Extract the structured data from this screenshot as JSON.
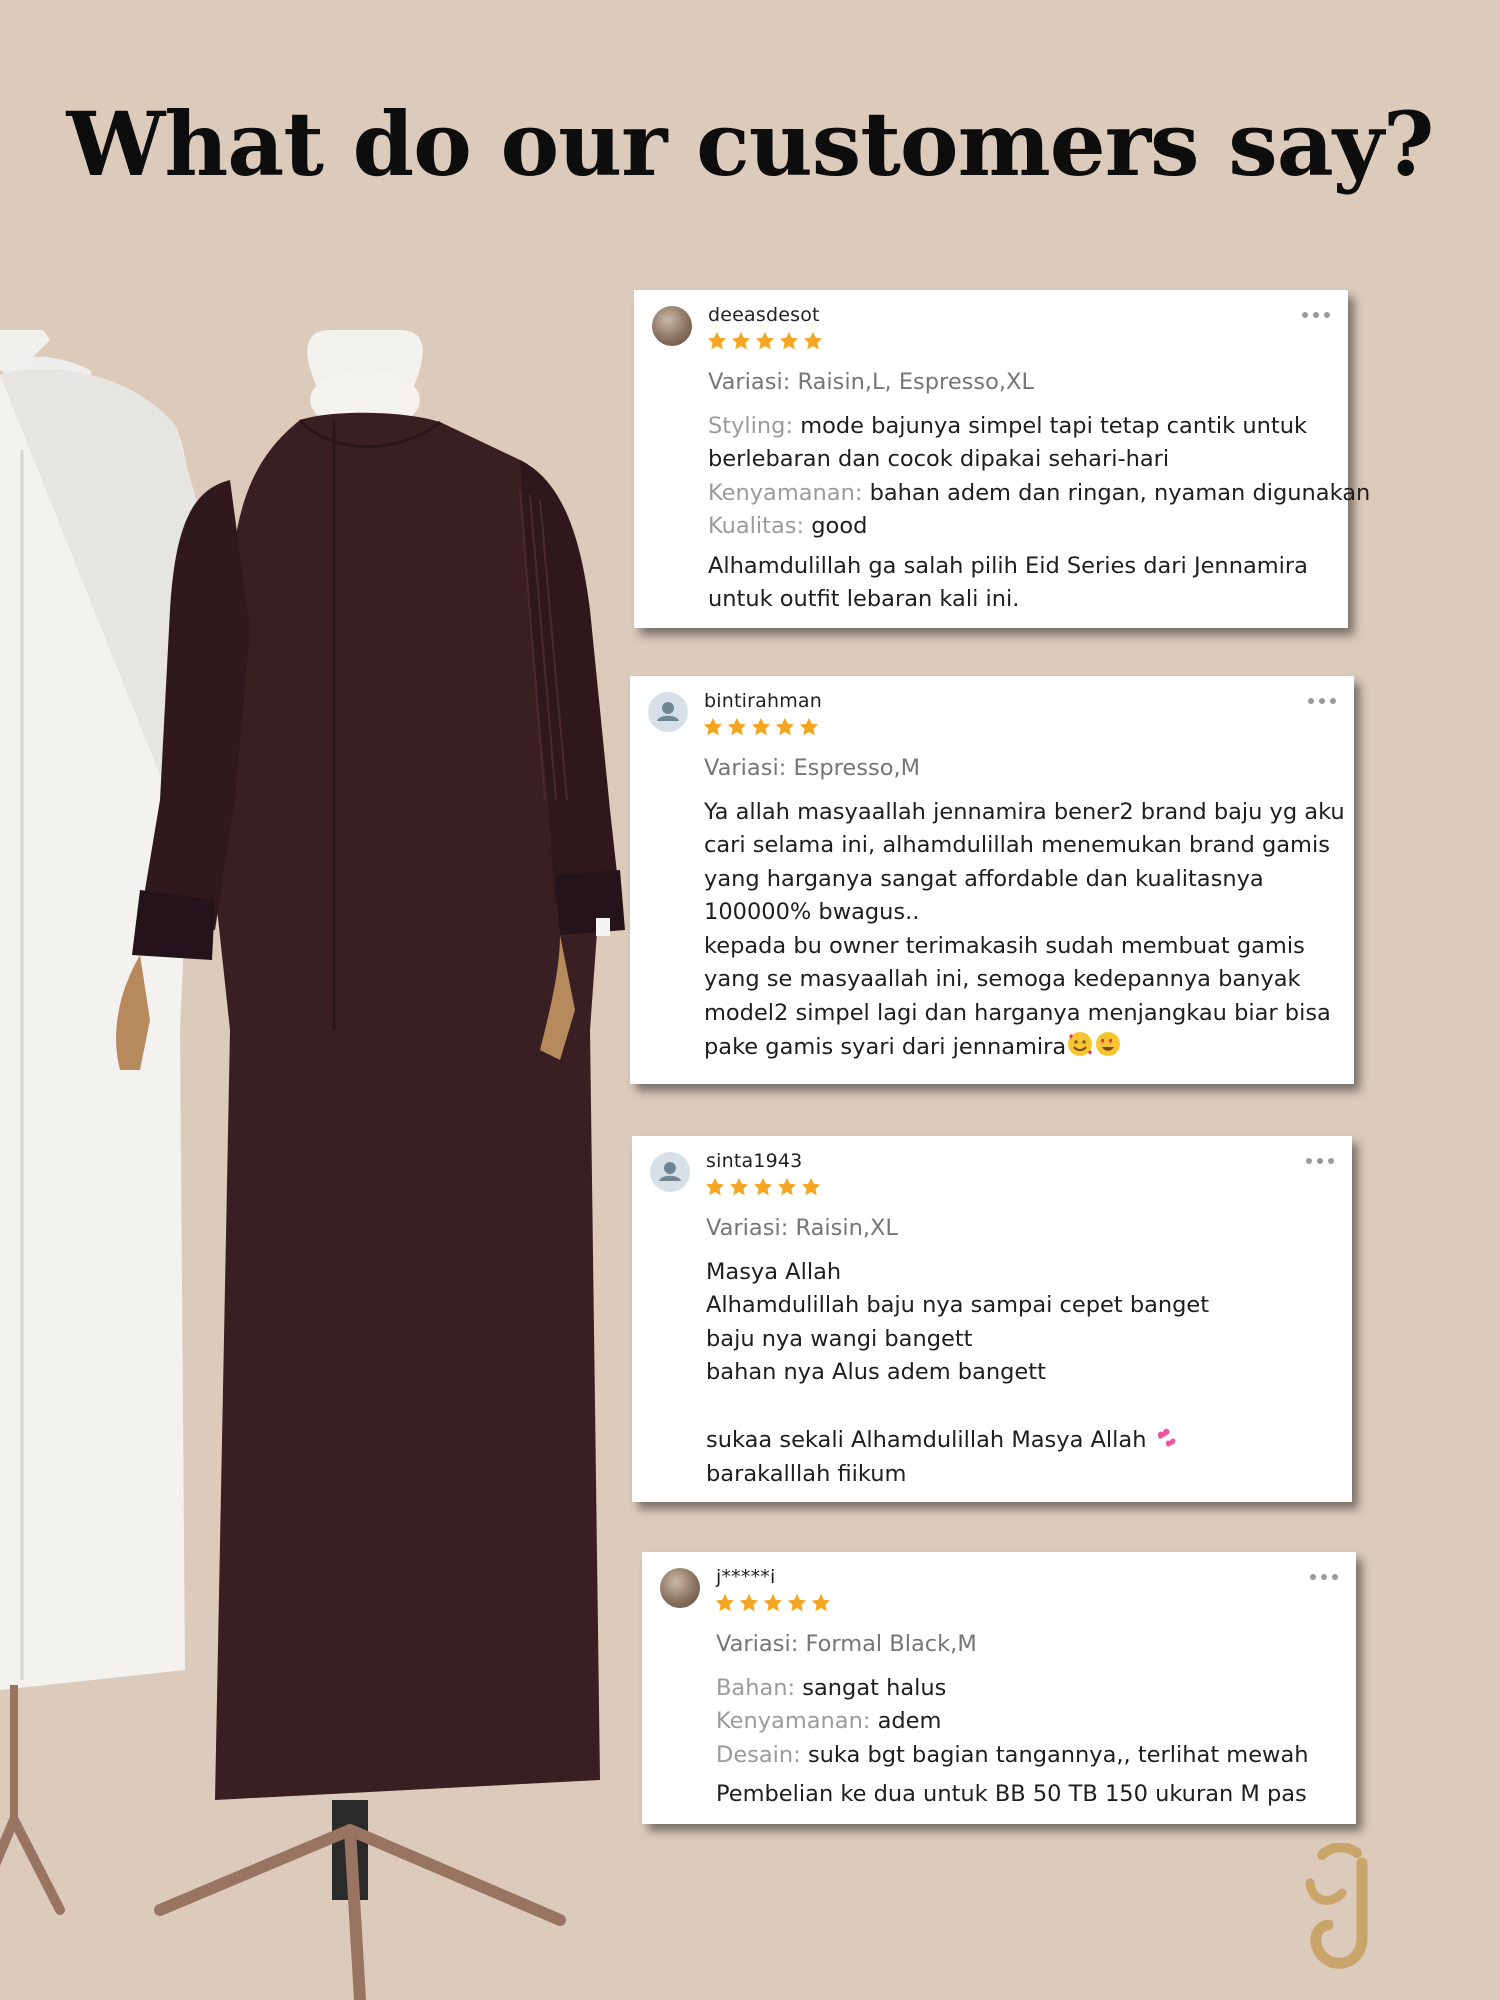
{
  "headline": "What do our customers say?",
  "reviews": [
    {
      "username": "deeasdesot",
      "stars": 5,
      "variasi_label": "Variasi:",
      "variasi_value": "Raisin,L, Espresso,XL",
      "fields": [
        {
          "label": "Styling:",
          "lines": [
            "mode bajunya simpel tapi tetap cantik untuk",
            "berlebaran dan cocok dipakai sehari-hari"
          ]
        },
        {
          "label": "Kenyamanan:",
          "lines": [
            "bahan adem dan ringan, nyaman digunakan"
          ]
        },
        {
          "label": "Kualitas:",
          "lines": [
            "good"
          ]
        }
      ],
      "text_lines": [
        "Alhamdulillah ga salah pilih Eid Series dari Jennamira",
        "untuk outfit lebaran kali ini."
      ]
    },
    {
      "username": "bintirahman",
      "stars": 5,
      "variasi_label": "Variasi:",
      "variasi_value": "Espresso,M",
      "text_lines": [
        "Ya allah masyaallah jennamira bener2 brand baju yg aku",
        "cari selama ini, alhamdulillah menemukan brand gamis",
        "yang harganya sangat affordable dan kualitasnya",
        "100000% bwagus..",
        "kepada bu owner terimakasih sudah membuat gamis",
        "yang se masyaallah ini, semoga kedepannya banyak",
        "model2 simpel lagi dan harganya menjangkau biar bisa",
        "pake gamis syari dari jennamira"
      ]
    },
    {
      "username": "sinta1943",
      "stars": 5,
      "variasi_label": "Variasi:",
      "variasi_value": "Raisin,XL",
      "text_lines": [
        "Masya Allah",
        "Alhamdulillah baju nya sampai cepet banget",
        "baju nya wangi bangett",
        "bahan nya Alus adem bangett",
        "",
        "sukaa sekali Alhamdulillah Masya Allah",
        "barakalllah fiikum"
      ]
    },
    {
      "username": "j*****i",
      "stars": 5,
      "variasi_label": "Variasi:",
      "variasi_value": "Formal Black,M",
      "fields": [
        {
          "label": "Bahan:",
          "lines": [
            "sangat halus"
          ]
        },
        {
          "label": "Kenyamanan:",
          "lines": [
            "adem"
          ]
        },
        {
          "label": "Desain:",
          "lines": [
            "suka bgt bagian tangannya,, terlihat mewah"
          ]
        }
      ],
      "text_lines": [
        "Pembelian ke dua untuk BB 50 TB 150 ukuran M pas"
      ]
    }
  ],
  "icons": {
    "star": "star-icon",
    "more": "more-options-icon",
    "avatar_default": "user-avatar-icon",
    "emoji_love": "smiling-face-with-hearts-emoji",
    "emoji_heart_eyes": "heart-eyes-emoji",
    "emoji_two_hearts": "two-hearts-emoji"
  },
  "colors": {
    "background": "#dccbbb",
    "star": "#f5a623",
    "dress": "#3a1f22",
    "logo": "#c9a56b"
  }
}
